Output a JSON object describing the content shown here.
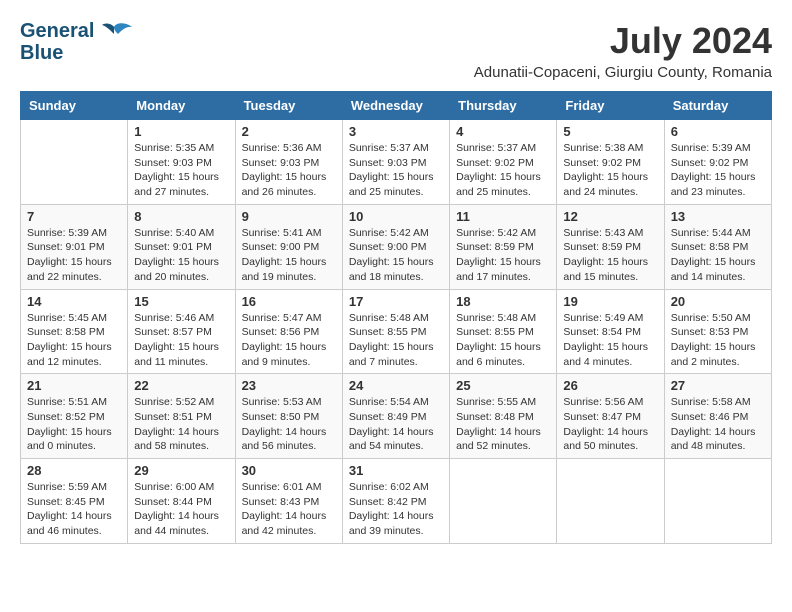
{
  "logo": {
    "line1": "General",
    "line2": "Blue"
  },
  "title": "July 2024",
  "location": "Adunatii-Copaceni, Giurgiu County, Romania",
  "weekdays": [
    "Sunday",
    "Monday",
    "Tuesday",
    "Wednesday",
    "Thursday",
    "Friday",
    "Saturday"
  ],
  "weeks": [
    [
      {
        "day": "",
        "info": ""
      },
      {
        "day": "1",
        "info": "Sunrise: 5:35 AM\nSunset: 9:03 PM\nDaylight: 15 hours\nand 27 minutes."
      },
      {
        "day": "2",
        "info": "Sunrise: 5:36 AM\nSunset: 9:03 PM\nDaylight: 15 hours\nand 26 minutes."
      },
      {
        "day": "3",
        "info": "Sunrise: 5:37 AM\nSunset: 9:03 PM\nDaylight: 15 hours\nand 25 minutes."
      },
      {
        "day": "4",
        "info": "Sunrise: 5:37 AM\nSunset: 9:02 PM\nDaylight: 15 hours\nand 25 minutes."
      },
      {
        "day": "5",
        "info": "Sunrise: 5:38 AM\nSunset: 9:02 PM\nDaylight: 15 hours\nand 24 minutes."
      },
      {
        "day": "6",
        "info": "Sunrise: 5:39 AM\nSunset: 9:02 PM\nDaylight: 15 hours\nand 23 minutes."
      }
    ],
    [
      {
        "day": "7",
        "info": "Sunrise: 5:39 AM\nSunset: 9:01 PM\nDaylight: 15 hours\nand 22 minutes."
      },
      {
        "day": "8",
        "info": "Sunrise: 5:40 AM\nSunset: 9:01 PM\nDaylight: 15 hours\nand 20 minutes."
      },
      {
        "day": "9",
        "info": "Sunrise: 5:41 AM\nSunset: 9:00 PM\nDaylight: 15 hours\nand 19 minutes."
      },
      {
        "day": "10",
        "info": "Sunrise: 5:42 AM\nSunset: 9:00 PM\nDaylight: 15 hours\nand 18 minutes."
      },
      {
        "day": "11",
        "info": "Sunrise: 5:42 AM\nSunset: 8:59 PM\nDaylight: 15 hours\nand 17 minutes."
      },
      {
        "day": "12",
        "info": "Sunrise: 5:43 AM\nSunset: 8:59 PM\nDaylight: 15 hours\nand 15 minutes."
      },
      {
        "day": "13",
        "info": "Sunrise: 5:44 AM\nSunset: 8:58 PM\nDaylight: 15 hours\nand 14 minutes."
      }
    ],
    [
      {
        "day": "14",
        "info": "Sunrise: 5:45 AM\nSunset: 8:58 PM\nDaylight: 15 hours\nand 12 minutes."
      },
      {
        "day": "15",
        "info": "Sunrise: 5:46 AM\nSunset: 8:57 PM\nDaylight: 15 hours\nand 11 minutes."
      },
      {
        "day": "16",
        "info": "Sunrise: 5:47 AM\nSunset: 8:56 PM\nDaylight: 15 hours\nand 9 minutes."
      },
      {
        "day": "17",
        "info": "Sunrise: 5:48 AM\nSunset: 8:55 PM\nDaylight: 15 hours\nand 7 minutes."
      },
      {
        "day": "18",
        "info": "Sunrise: 5:48 AM\nSunset: 8:55 PM\nDaylight: 15 hours\nand 6 minutes."
      },
      {
        "day": "19",
        "info": "Sunrise: 5:49 AM\nSunset: 8:54 PM\nDaylight: 15 hours\nand 4 minutes."
      },
      {
        "day": "20",
        "info": "Sunrise: 5:50 AM\nSunset: 8:53 PM\nDaylight: 15 hours\nand 2 minutes."
      }
    ],
    [
      {
        "day": "21",
        "info": "Sunrise: 5:51 AM\nSunset: 8:52 PM\nDaylight: 15 hours\nand 0 minutes."
      },
      {
        "day": "22",
        "info": "Sunrise: 5:52 AM\nSunset: 8:51 PM\nDaylight: 14 hours\nand 58 minutes."
      },
      {
        "day": "23",
        "info": "Sunrise: 5:53 AM\nSunset: 8:50 PM\nDaylight: 14 hours\nand 56 minutes."
      },
      {
        "day": "24",
        "info": "Sunrise: 5:54 AM\nSunset: 8:49 PM\nDaylight: 14 hours\nand 54 minutes."
      },
      {
        "day": "25",
        "info": "Sunrise: 5:55 AM\nSunset: 8:48 PM\nDaylight: 14 hours\nand 52 minutes."
      },
      {
        "day": "26",
        "info": "Sunrise: 5:56 AM\nSunset: 8:47 PM\nDaylight: 14 hours\nand 50 minutes."
      },
      {
        "day": "27",
        "info": "Sunrise: 5:58 AM\nSunset: 8:46 PM\nDaylight: 14 hours\nand 48 minutes."
      }
    ],
    [
      {
        "day": "28",
        "info": "Sunrise: 5:59 AM\nSunset: 8:45 PM\nDaylight: 14 hours\nand 46 minutes."
      },
      {
        "day": "29",
        "info": "Sunrise: 6:00 AM\nSunset: 8:44 PM\nDaylight: 14 hours\nand 44 minutes."
      },
      {
        "day": "30",
        "info": "Sunrise: 6:01 AM\nSunset: 8:43 PM\nDaylight: 14 hours\nand 42 minutes."
      },
      {
        "day": "31",
        "info": "Sunrise: 6:02 AM\nSunset: 8:42 PM\nDaylight: 14 hours\nand 39 minutes."
      },
      {
        "day": "",
        "info": ""
      },
      {
        "day": "",
        "info": ""
      },
      {
        "day": "",
        "info": ""
      }
    ]
  ]
}
